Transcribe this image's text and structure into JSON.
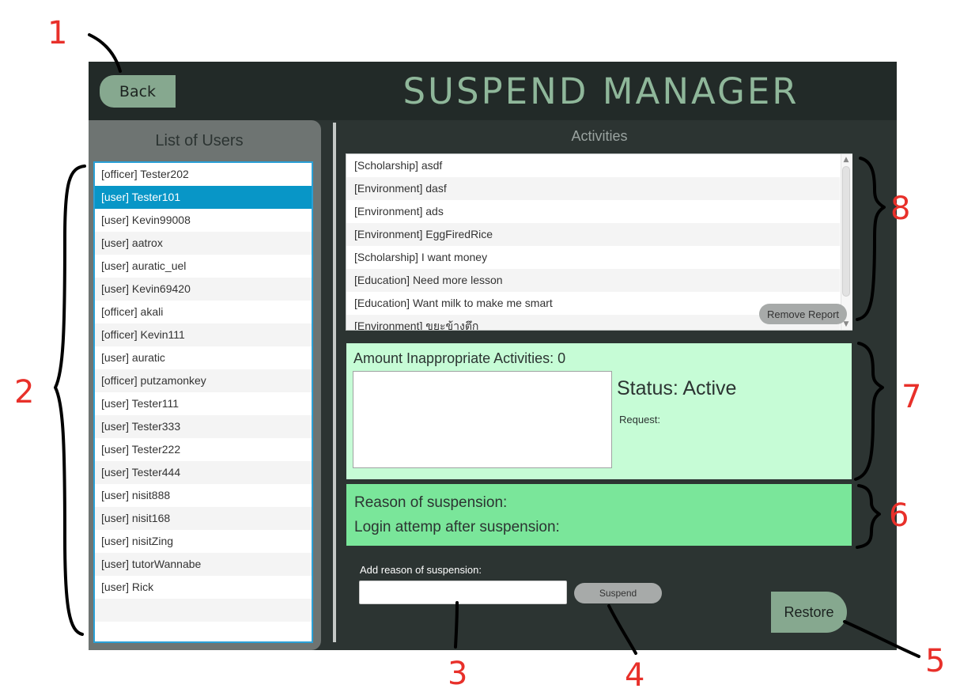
{
  "header": {
    "back_label": "Back",
    "title": "SUSPEND MANAGER"
  },
  "users_panel": {
    "heading": "List of Users",
    "selected_index": 1,
    "items": [
      "[officer] Tester202",
      "[user] Tester101",
      "[user] Kevin99008",
      "[user] aatrox",
      "[user] auratic_uel",
      "[user] Kevin69420",
      "[officer] akali",
      "[officer] Kevin111",
      "[user] auratic",
      "[officer] putzamonkey",
      "[user] Tester111",
      "[user] Tester333",
      "[user] Tester222",
      "[user] Tester444",
      "[user] nisit888",
      "[user] nisit168",
      "[user] nisitZing",
      "[user] tutorWannabe",
      "[user] Rick"
    ]
  },
  "activities_panel": {
    "heading": "Activities",
    "items": [
      "[Scholarship] asdf",
      "[Environment] dasf",
      "[Environment] ads",
      "[Environment] EggFiredRice",
      "[Scholarship] I want money",
      "[Education] Need more lesson",
      "[Education] Want milk to make me smart",
      "[Environment] ขยะข้างตึก"
    ],
    "remove_report_label": "Remove Report"
  },
  "status_panel": {
    "amount_label": "Amount Inappropriate Activities: 0",
    "status_label": "Status: Active",
    "request_label": "Request:"
  },
  "suspension_panel": {
    "reason_label": "Reason of suspension:",
    "attempt_label": "Login attemp after suspension:"
  },
  "suspend_form": {
    "add_reason_label": "Add reason of suspension:",
    "input_value": "",
    "suspend_label": "Suspend",
    "restore_label": "Restore"
  },
  "annotations": [
    "1",
    "2",
    "3",
    "4",
    "5",
    "6",
    "7",
    "8"
  ],
  "colors": {
    "window_bg": "#2c3432",
    "header_bg": "#222a28",
    "accent_green": "#86a88f",
    "title_green": "#8fb79a",
    "status_bg": "#c6fcd6",
    "suspension_bg": "#7ae69a",
    "selection_blue": "#0896c7",
    "annotation_red": "#e8302a"
  }
}
